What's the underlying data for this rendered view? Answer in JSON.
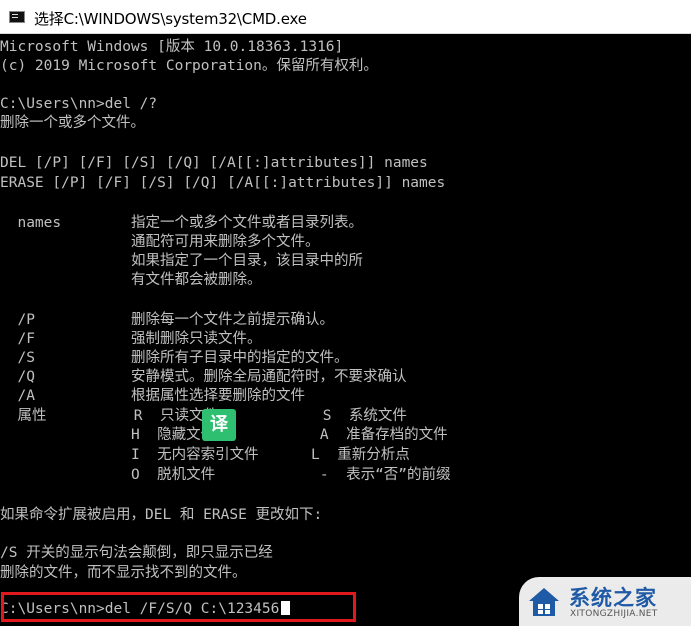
{
  "window": {
    "title": "选择C:\\WINDOWS\\system32\\CMD.exe",
    "icon": "cmd-app-icon"
  },
  "console": {
    "lines": [
      "Microsoft Windows [版本 10.0.18363.1316]",
      "(c) 2019 Microsoft Corporation。保留所有权利。",
      "",
      "C:\\Users\\nn>del /?",
      "删除一个或多个文件。",
      "",
      "DEL [/P] [/F] [/S] [/Q] [/A[[:]attributes]] names",
      "ERASE [/P] [/F] [/S] [/Q] [/A[[:]attributes]] names",
      "",
      "  names        指定一个或多个文件或者目录列表。",
      "               通配符可用来删除多个文件。",
      "               如果指定了一个目录，该目录中的所",
      "               有文件都会被删除。",
      "",
      "  /P           删除每一个文件之前提示确认。",
      "  /F           强制删除只读文件。",
      "  /S           删除所有子目录中的指定的文件。",
      "  /Q           安静模式。删除全局通配符时，不要求确认",
      "  /A           根据属性选择要删除的文件",
      "  属性          R  只读文件            S  系统文件",
      "               H  隐藏文件            A  准备存档的文件",
      "               I  无内容索引文件      L  重新分析点",
      "               O  脱机文件            -  表示“否”的前缀",
      "",
      "如果命令扩展被启用，DEL 和 ERASE 更改如下:",
      "",
      "/S 开关的显示句法会颠倒，即只显示已经",
      "删除的文件，而不显示找不到的文件。",
      "",
      "C:\\Users\\nn>del /F/S/Q C:\\123456"
    ]
  },
  "overlay": {
    "translate_label": "译"
  },
  "watermark": {
    "name": "系统之家",
    "url": "XITONGZHIJIA.NET"
  },
  "colors": {
    "console_bg": "#000000",
    "console_text": "#c0c0c0",
    "highlight": "#e0191e",
    "translate_badge": "#2fbf71",
    "watermark_blue": "#1f5aa6"
  }
}
